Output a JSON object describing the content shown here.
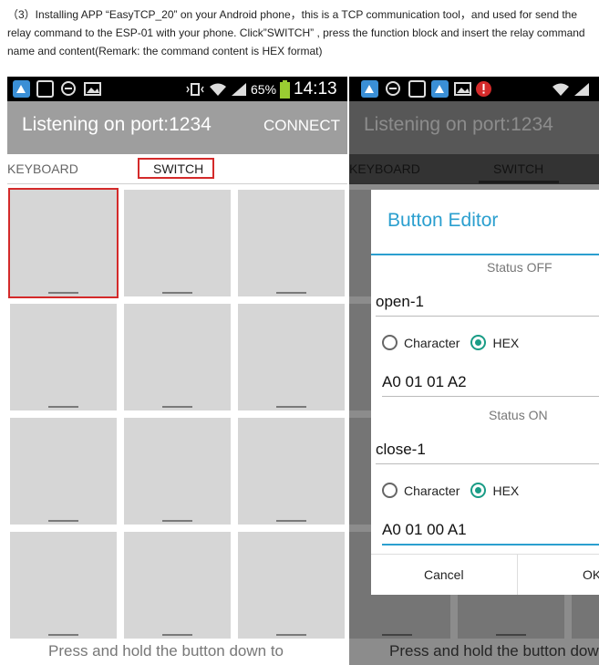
{
  "caption": {
    "line1": "（3）Installing APP “EasyTCP_20” on your Android phone，this is a TCP communication tool，and used for send the",
    "line2": "relay command to the ESP-01 with your phone. Click”SWITCH” , press the function block and insert the relay command",
    "line3": "name and content(Remark: the command content is HEX format)"
  },
  "phone_left": {
    "status_bar": {
      "battery": "65%",
      "time": "14:13"
    },
    "app_bar": {
      "title": "Listening on port:1234",
      "action": "CONNECT"
    },
    "tabs": [
      "KEYBOARD",
      "SWITCH"
    ],
    "active_tab": "SWITCH",
    "grid_buttons": 12,
    "hint": "Press and hold the button down to"
  },
  "phone_right": {
    "app_bar": {
      "title": "Listening on port:1234"
    },
    "tabs": [
      "KEYBOARD",
      "SWITCH"
    ],
    "hint": "Press and hold the button down",
    "dialog": {
      "title": "Button Editor",
      "status_off_label": "Status OFF",
      "off_name": "open-1",
      "off_mode_options": [
        "Character",
        "HEX"
      ],
      "off_mode_selected": "HEX",
      "off_content": "A0 01 01 A2",
      "status_on_label": "Status ON",
      "on_name": "close-1",
      "on_mode_options": [
        "Character",
        "HEX"
      ],
      "on_mode_selected": "HEX",
      "on_content": "A0 01 00 A1",
      "cancel_label": "Cancel",
      "ok_label": "OK"
    }
  },
  "colors": {
    "accent": "#2b9fcf",
    "radio_checked": "#199c86",
    "highlight_box": "#d42a2a",
    "app_bar": "#9e9e9e"
  },
  "icons": [
    "app-launcher-icon",
    "square-icon",
    "photo-icon",
    "vibrate-icon",
    "wifi-icon",
    "signal-icon",
    "battery-icon",
    "alert-icon"
  ]
}
